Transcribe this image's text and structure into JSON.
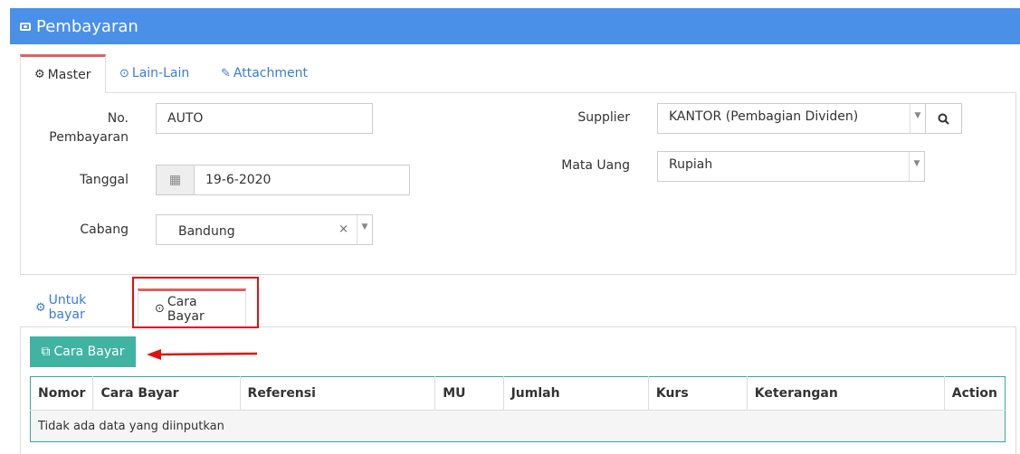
{
  "header": {
    "title": "Pembayaran",
    "icon": "money-icon",
    "color": "#4a90e8"
  },
  "top_tabs": [
    {
      "label": "Master",
      "icon": "gears-icon",
      "active": true
    },
    {
      "label": "Lain-Lain",
      "icon": "check-circle-icon",
      "active": false
    },
    {
      "label": "Attachment",
      "icon": "paperclip-icon",
      "active": false
    }
  ],
  "form": {
    "no_pembayaran": {
      "label_line1": "No.",
      "label_line2": "Pembayaran",
      "value": "AUTO"
    },
    "tanggal": {
      "label": "Tanggal",
      "value": "19-6-2020"
    },
    "cabang": {
      "label": "Cabang",
      "value": "Bandung",
      "clear": "×",
      "caret": "▼"
    },
    "supplier": {
      "label": "Supplier",
      "value": "KANTOR (Pembagian Dividen)",
      "caret": "▼"
    },
    "mata_uang": {
      "label": "Mata Uang",
      "value": "Rupiah",
      "caret": "▼"
    }
  },
  "bottom_tabs": [
    {
      "label": "Untuk bayar",
      "icon": "gears-icon",
      "active": false
    },
    {
      "label": "Cara Bayar",
      "icon": "check-circle-icon",
      "active": true
    }
  ],
  "cara_bayar_button": {
    "label": "Cara Bayar",
    "icon": "copy-icon",
    "color": "#41b3a3"
  },
  "table": {
    "columns": [
      "Nomor",
      "Cara Bayar",
      "Referensi",
      "MU",
      "Jumlah",
      "Kurs",
      "Keterangan",
      "Action"
    ],
    "empty_text": "Tidak ada data yang diinputkan"
  },
  "annotation_color": "#e01010"
}
